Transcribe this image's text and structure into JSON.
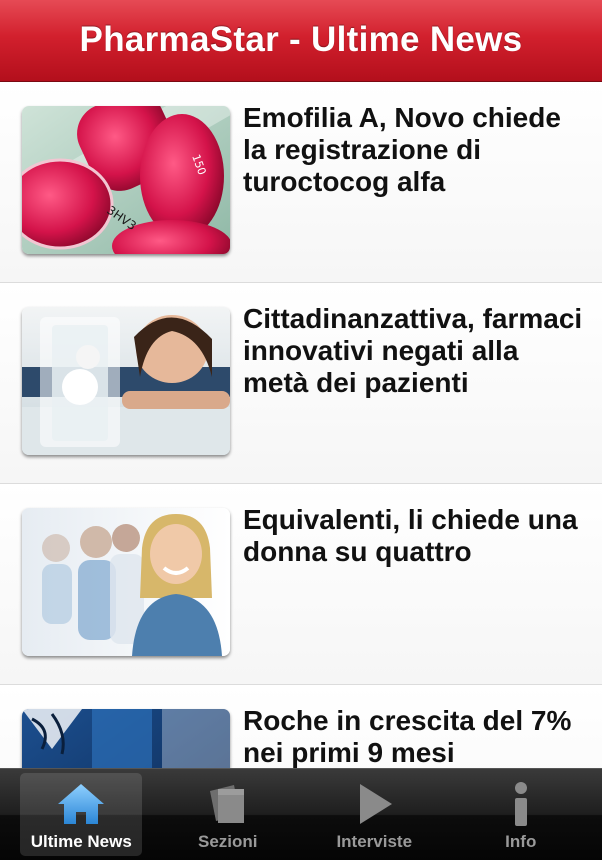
{
  "header": {
    "title": "PharmaStar - Ultime News"
  },
  "articles": [
    {
      "title": "Emofilia A, Novo chiede la registrazione di turoctocog alfa",
      "image": "lab-test-tubes"
    },
    {
      "title": "Cittadinanzattiva, farmaci innovativi negati alla metà dei pazienti",
      "image": "woman-with-glass"
    },
    {
      "title": "Equivalenti, li chiede una donna su quattro",
      "image": "smiling-woman-office"
    },
    {
      "title": "Roche in crescita del 7% nei primi 9 mesi",
      "image": "blue-building"
    }
  ],
  "tabs": [
    {
      "label": "Ultime News",
      "icon": "home-icon",
      "active": true
    },
    {
      "label": "Sezioni",
      "icon": "pages-icon",
      "active": false
    },
    {
      "label": "Interviste",
      "icon": "play-icon",
      "active": false
    },
    {
      "label": "Info",
      "icon": "info-icon",
      "active": false
    }
  ],
  "colors": {
    "header": "#d2202d",
    "tabbar": "#1e1e1e",
    "active_icon": "#4da6e8"
  }
}
